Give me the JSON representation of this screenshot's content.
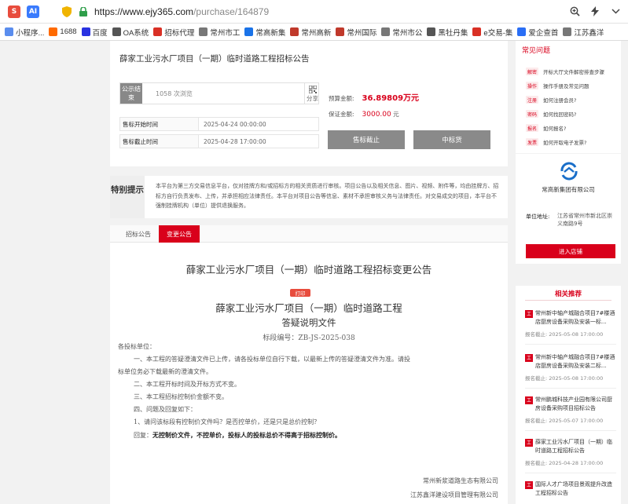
{
  "browser": {
    "url_host": "https://www.ejy365.com",
    "url_path": "/purchase/164879",
    "bookmarks": [
      {
        "label": "小程序...",
        "color": "#5a8dee"
      },
      {
        "label": "1688",
        "color": "#ff6a00"
      },
      {
        "label": "百度",
        "color": "#2932e1"
      },
      {
        "label": "OA系统",
        "color": "#555555"
      },
      {
        "label": "招标代理",
        "color": "#d93025"
      },
      {
        "label": "常州市工",
        "color": "#777777"
      },
      {
        "label": "常高新集",
        "color": "#1a73e8"
      },
      {
        "label": "常州高新",
        "color": "#c0392b"
      },
      {
        "label": "常州国际",
        "color": "#c0392b"
      },
      {
        "label": "常州市公",
        "color": "#777777"
      },
      {
        "label": "黑牡丹集",
        "color": "#555555"
      },
      {
        "label": "e交易-集",
        "color": "#d93025"
      },
      {
        "label": "爱企查首",
        "color": "#2a6ef5"
      },
      {
        "label": "江苏鑫洋",
        "color": "#777777"
      }
    ]
  },
  "header": {
    "title": "薛家工业污水厂项目（一期）临时道路工程招标公告",
    "pub_label": "公示结束",
    "views": "1058 次浏览",
    "share": "分享"
  },
  "info": {
    "start_label": "售标开始时间",
    "start_value": "2025-04-24 00:00:00",
    "end_label": "售标截止时间",
    "end_value": "2025-04-28 17:00:00",
    "budget_label": "预算金额:",
    "budget_value": "36.89809万元",
    "deposit_label": "保证金额:",
    "deposit_value": "3000.00",
    "deposit_unit": "元",
    "btn_closed": "售标截止",
    "btn_winner": "中标货"
  },
  "notice": {
    "label": "特别提示",
    "text": "本平台为第三方交易信息平台，仅对挂牌方和/或招标方的相关资质进行审核。项目公告以及相关信息、图片、视频、附件等，均由挂牌方、招标方自行负责发布、上传，并承担相应法律责任。本平台对项目公告等信息、素材不承担审核义务与法律责任。对交易成交的项目，本平台不强制挂牌机构（单位）提供退换服务。"
  },
  "tabs": {
    "tab1": "招标公告",
    "tab2": "变更公告"
  },
  "doc": {
    "title": "薛家工业污水厂项目（一期）临时道路工程招标变更公告",
    "print": "打印",
    "h1": "薛家工业污水厂项目（一期）临时道路工程",
    "h2": "答疑说明文件",
    "h3": "标段编号：ZB-JS-2025-038",
    "p0": "各投标单位：",
    "p1": "一、本工程的答疑澄清文件已上传，请各投标单位自行下载，以最新上传的答疑澄清文件为准。请投",
    "p1b": "标单位务必下载最新的澄清文件。",
    "p2": "二、本工程开标时间及开标方式不变。",
    "p3": "三、本工程招标控制价金额不变。",
    "p4": "四、问题及回复如下：",
    "p5": "1、请问该标段有控制价文件吗？是否控单价，还是只是总价控制？",
    "p6_label": "回复：",
    "p6": "无控制价文件，不控单价，投标人的投标总价不得高于招标控制价。",
    "sig1": "常州新浆道路生态有限公司",
    "sig2": "江苏鑫洋建设项目管理有限公司"
  },
  "faq": {
    "title": "常见问题",
    "items": [
      {
        "tag": "解密",
        "text": "开标大厅文件解密排查步骤"
      },
      {
        "tag": "操作",
        "text": "操作手册及常见问题"
      },
      {
        "tag": "注册",
        "text": "如何注册会员?"
      },
      {
        "tag": "密码",
        "text": "如何找回密码?"
      },
      {
        "tag": "报名",
        "text": "如何报名?"
      },
      {
        "tag": "发票",
        "text": "如何开取电子发票?"
      }
    ]
  },
  "company": {
    "name": "常高新集团有限公司",
    "addr_label": "单位地址:",
    "addr_value": "江苏省常州市新北区崇义南路9号",
    "enter": "进入店铺"
  },
  "recommend": {
    "title": "相关推荐",
    "items": [
      {
        "tag": "工",
        "title": "常州新中轴产城融合项目7#楼酒店厨房设备采购及安装一标...",
        "date": "报名截止: 2025-05-08 17:00:00"
      },
      {
        "tag": "工",
        "title": "常州新中轴产城融合项目7#楼酒店厨房设备采购及安装二标...",
        "date": "报名截止: 2025-05-08 17:00:00"
      },
      {
        "tag": "工",
        "title": "常州鹏城科技产业园有限公司厨房设备采购项目招标公告",
        "date": "报名截止: 2025-05-07 17:00:00"
      },
      {
        "tag": "工",
        "title": "薛家工业污水厂项目（一期）临时道路工程招标公告",
        "date": "报名截止: 2025-04-28 17:00:00"
      },
      {
        "tag": "工",
        "title": "国际人才广场项目景观提升改造工程招标公告",
        "date": ""
      }
    ]
  }
}
